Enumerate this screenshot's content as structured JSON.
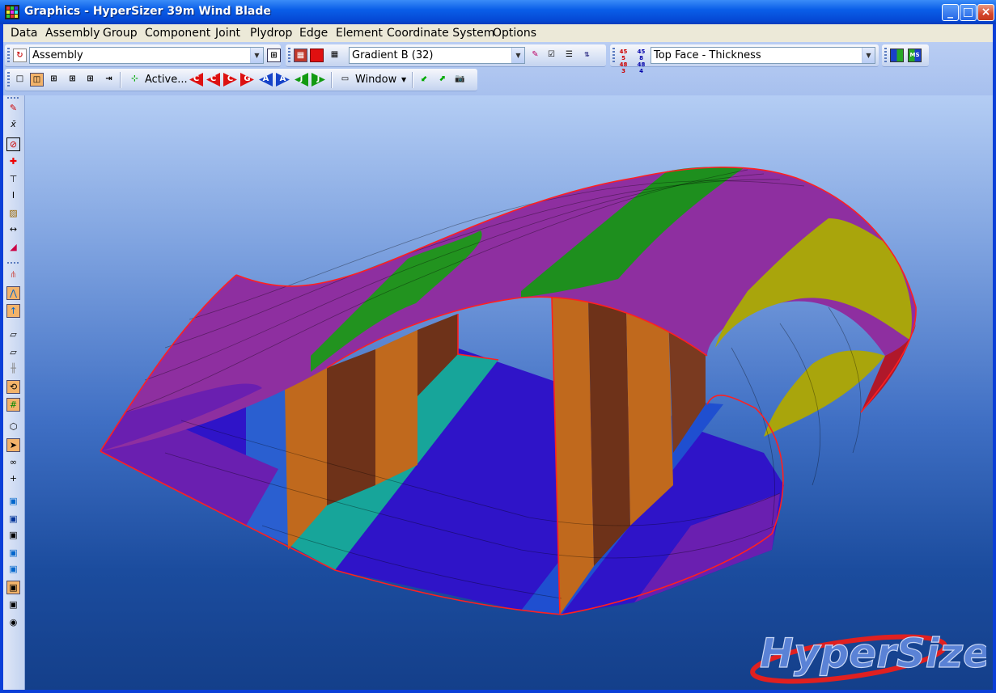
{
  "window": {
    "title": "Graphics - HyperSizer 39m Wind Blade",
    "minimize_label": "_",
    "maximize_label": "□",
    "close_label": "×"
  },
  "menu": [
    "Data",
    "Assembly",
    "Group",
    "Component",
    "Joint",
    "Plydrop",
    "Edge",
    "Element",
    "Coordinate System",
    "Options"
  ],
  "toolbar": {
    "assembly_value": "Assembly",
    "gradient_value": "Gradient B (32)",
    "face_value": "Top Face - Thickness",
    "active_label": "Active...",
    "window_label": "Window",
    "nav_buttons": [
      "C",
      "C",
      "C",
      "G",
      "A",
      "A",
      "J",
      "J"
    ]
  },
  "logo_text": "HyperSizer",
  "colors": {
    "purple": "#8e2fa0",
    "magenta": "#a0208f",
    "green": "#22931f",
    "dark_green": "#1e7a1e",
    "olive": "#a9a50c",
    "blue": "#2f14c8",
    "teal": "#17a59a",
    "orange": "#c0691d",
    "brown": "#6e3219",
    "edge_red": "#ff2020"
  }
}
